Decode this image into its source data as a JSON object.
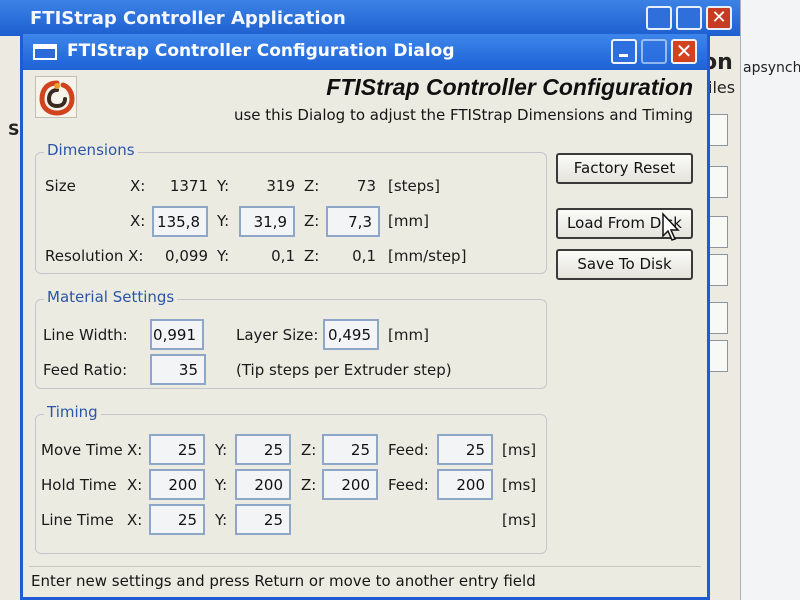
{
  "main_window": {
    "title": "FTIStrap Controller Application",
    "fragments": {
      "heading_tail": "on",
      "text1": "apsynchr",
      "text2": "iles",
      "left": "Se"
    }
  },
  "dialog": {
    "title": "FTIStrap Controller Configuration Dialog",
    "header_title": "FTIStrap Controller Configuration",
    "header_subtitle": "use this Dialog to adjust the FTIStrap Dimensions and Timing",
    "close_glyph": "✕"
  },
  "dimensions": {
    "group_title": "Dimensions",
    "size_label": "Size",
    "x_label": "X:",
    "y_label": "Y:",
    "z_label": "Z:",
    "steps": {
      "x": "1371",
      "y": "319",
      "z": "73",
      "unit": "[steps]"
    },
    "mm": {
      "x": "135,8",
      "y": "31,9",
      "z": "7,3",
      "unit": "[mm]"
    },
    "resolution_label": "Resolution X:",
    "resolution": {
      "x": "0,099",
      "y": "0,1",
      "z": "0,1",
      "unit": "[mm/step]"
    }
  },
  "material": {
    "group_title": "Material Settings",
    "line_width_label": "Line Width:",
    "line_width": "0,991",
    "layer_size_label": "Layer Size:",
    "layer_size": "0,495",
    "layer_unit": "[mm]",
    "feed_ratio_label": "Feed Ratio:",
    "feed_ratio": "35",
    "feed_ratio_note": "(Tip steps per Extruder step)"
  },
  "timing": {
    "group_title": "Timing",
    "x_label": "X:",
    "y_label": "Y:",
    "z_label": "Z:",
    "feed_label": "Feed:",
    "unit": "[ms]",
    "move": {
      "label": "Move Time",
      "x": "25",
      "y": "25",
      "z": "25",
      "feed": "25"
    },
    "hold": {
      "label": "Hold Time",
      "x": "200",
      "y": "200",
      "z": "200",
      "feed": "200"
    },
    "line": {
      "label": "Line Time",
      "x": "25",
      "y": "25"
    }
  },
  "buttons": {
    "factory_reset": "Factory Reset",
    "load_from_disk": "Load From Disk",
    "save_to_disk": "Save To Disk"
  },
  "status_bar": "Enter new settings and press Return or move to another entry field",
  "colors": {
    "titlebar": "#1e62d6",
    "group_title": "#2b55a8",
    "close_button": "#d2421f"
  }
}
